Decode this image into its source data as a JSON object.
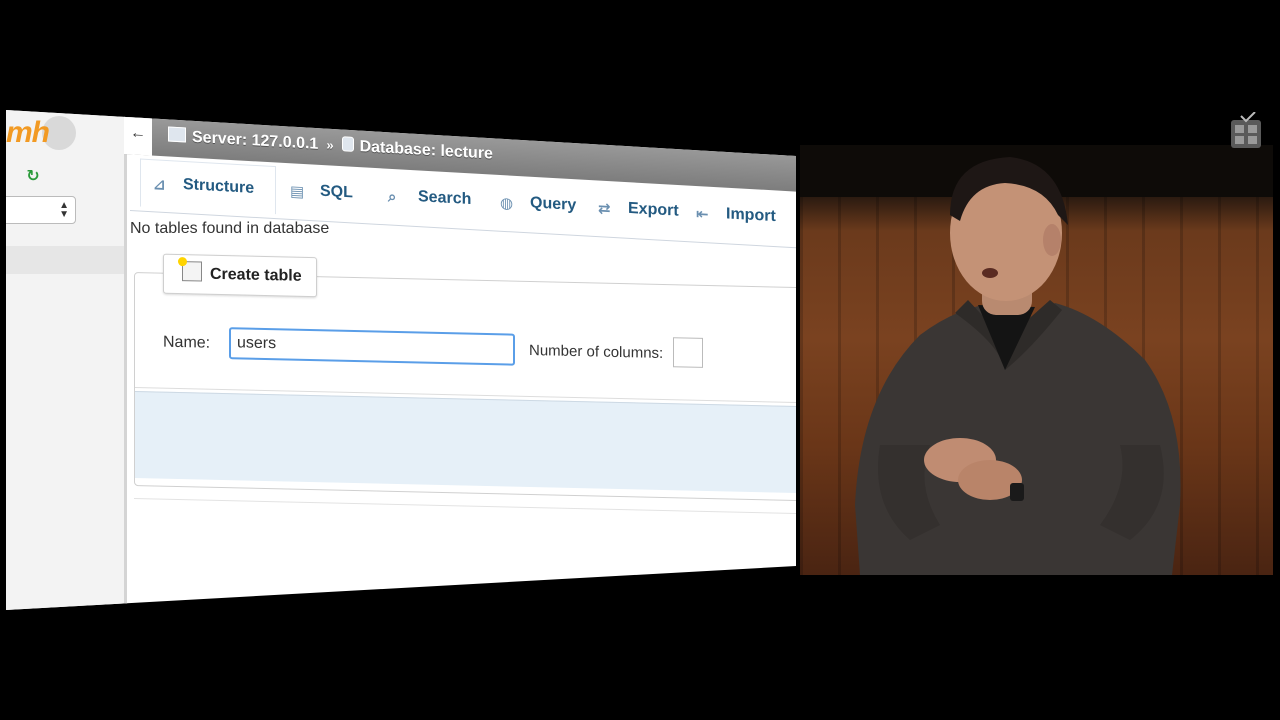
{
  "sidebar": {
    "logo_text": "mh"
  },
  "topbar": {
    "back_label": "←",
    "server_label": "Server: 127.0.0.1",
    "separator": "»",
    "database_label": "Database: lecture"
  },
  "tabs": [
    {
      "label": "Structure",
      "icon": "structure-icon",
      "active": true
    },
    {
      "label": "SQL",
      "icon": "sql-icon",
      "active": false
    },
    {
      "label": "Search",
      "icon": "search-icon",
      "active": false
    },
    {
      "label": "Query",
      "icon": "query-icon",
      "active": false
    },
    {
      "label": "Export",
      "icon": "export-icon",
      "active": false
    },
    {
      "label": "Import",
      "icon": "import-icon",
      "active": false
    }
  ],
  "main": {
    "no_tables_text": "No tables found in database",
    "create_table": {
      "legend": "Create table",
      "name_label": "Name:",
      "name_value": "users",
      "columns_label": "Number of columns:",
      "columns_value": ""
    }
  },
  "colors": {
    "tab_text": "#235a81",
    "input_focus_border": "#5a9ee8",
    "logo": "#f29a23",
    "footer_bg": "#e6f0f8"
  }
}
